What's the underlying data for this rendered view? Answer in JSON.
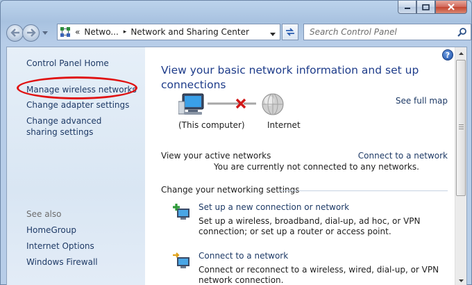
{
  "window": {
    "caption_buttons": [
      "minimize-icon",
      "maximize-icon",
      "close-icon"
    ]
  },
  "nav": {
    "breadcrumb_overflow": "«",
    "breadcrumb_1": "Netwo...",
    "breadcrumb_sep": "▸",
    "breadcrumb_2": "Network and Sharing Center",
    "search_placeholder": "Search Control Panel"
  },
  "sidebar": {
    "home": "Control Panel Home",
    "items": [
      {
        "label": "Manage wireless networks"
      },
      {
        "label": "Change adapter settings"
      },
      {
        "label": "Change advanced sharing settings"
      }
    ],
    "see_also_heading": "See also",
    "see_also": [
      {
        "label": "HomeGroup"
      },
      {
        "label": "Internet Options"
      },
      {
        "label": "Windows Firewall"
      }
    ],
    "annotation_color": "#e01212"
  },
  "main": {
    "title": "View your basic network information and set up connections",
    "see_full_map": "See full map",
    "map": {
      "computer_label": "(This computer)",
      "internet_label": "Internet",
      "status": "disconnected"
    },
    "active_networks_label": "View your active networks",
    "connect_link": "Connect to a network",
    "not_connected": "You are currently not connected to any networks.",
    "change_settings_label": "Change your networking settings",
    "tasks": [
      {
        "title": "Set up a new connection or network",
        "description": "Set up a wireless, broadband, dial-up, ad hoc, or VPN connection; or set up a router or access point.",
        "icon": "new-connection-icon"
      },
      {
        "title": "Connect to a network",
        "description": "Connect or reconnect to a wireless, wired, dial-up, or VPN network connection.",
        "icon": "connect-network-icon"
      }
    ]
  },
  "colors": {
    "link": "#1e3a66",
    "title": "#1e3c8a",
    "disconnect_x": "#d01818"
  }
}
